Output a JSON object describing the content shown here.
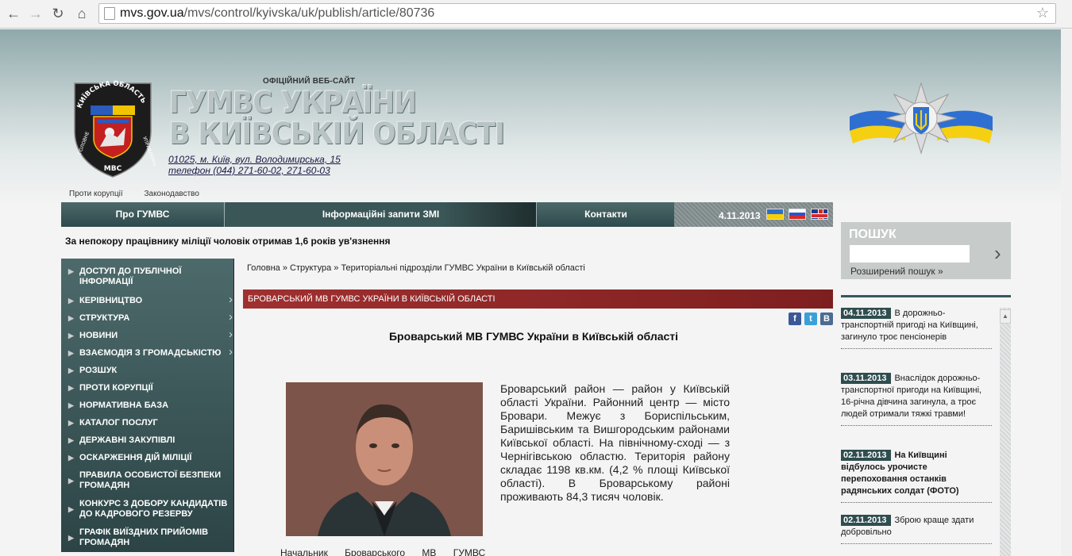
{
  "browser": {
    "url_host": "mvs.gov.ua",
    "url_path": "/mvs/control/kyivska/uk/publish/article/80736"
  },
  "header": {
    "official_label": "ОФІЦІЙНИЙ ВЕБ-САЙТ",
    "title_line1": "ГУМВС УКРАЇНИ",
    "title_line2": "В КИЇВСЬКІЙ ОБЛАСТІ",
    "address_line1": "01025, м. Київ, вул. Володимирська, 15",
    "address_line2": "телефон (044) 271-60-02, 271-60-03",
    "emblem_top": "КИЇВСЬКА ОБЛАСТЬ",
    "emblem_bottom": "ГОЛОВНЕ МВС УПРАВЛІННЯ"
  },
  "toplinks": [
    "Проти корупції",
    "Законодавство"
  ],
  "menu": {
    "items": [
      "Про ГУМВС",
      "Інформаційні запити ЗМІ",
      "Контакти"
    ],
    "date": "4.11.2013"
  },
  "ticker": "За непокору працівнику міліції чоловік отримав 1,6 років ув'язнення",
  "sidebar": {
    "items": [
      {
        "label": "ДОСТУП ДО ПУБЛІЧНОЇ ІНФОРМАЦІЇ",
        "arrow": ""
      },
      {
        "label": "КЕРІВНИЦТВО",
        "arrow": "›"
      },
      {
        "label": "СТРУКТУРА",
        "arrow": "›"
      },
      {
        "label": "НОВИНИ",
        "arrow": "›"
      },
      {
        "label": "ВЗАЄМОДІЯ З ГРОМАДСЬКІСТЮ",
        "arrow": "›"
      },
      {
        "label": "РОЗШУК",
        "arrow": ""
      },
      {
        "label": "ПРОТИ КОРУПЦІЇ",
        "arrow": ""
      },
      {
        "label": "НОРМАТИВНА БАЗА",
        "arrow": ""
      },
      {
        "label": "КАТАЛОГ ПОСЛУГ",
        "arrow": ""
      },
      {
        "label": "ДЕРЖАВНІ ЗАКУПІВЛІ",
        "arrow": ""
      },
      {
        "label": "ОСКАРЖЕННЯ ДІЙ МІЛІЦІЇ",
        "arrow": ""
      },
      {
        "label": "ПРАВИЛА ОСОБИСТОЇ БЕЗПЕКИ ГРОМАДЯН",
        "arrow": ""
      },
      {
        "label": "КОНКУРС З ДОБОРУ КАНДИДАТІВ ДО КАДРОВОГО РЕЗЕРВУ",
        "arrow": ""
      },
      {
        "label": "ГРАФІК ВИЇЗДНИХ ПРИЙОМІВ ГРОМАДЯН",
        "arrow": ""
      }
    ]
  },
  "search": {
    "label": "ПОШУК",
    "value": "",
    "advanced": "Розширений пошук »"
  },
  "news": [
    {
      "date": "04.11.2013",
      "text": "В дорожньо-транспортній пригоді на Київщині, загинуло троє пенсіонерів",
      "bold": false
    },
    {
      "date": "03.11.2013",
      "text": "Внаслідок дорожньо-транспортної пригоди на Київщині, 16-річна дівчина загинула, а троє людей отримали тяжкі травми!",
      "bold": false
    },
    {
      "date": "02.11.2013",
      "text": "На Київщині відбулось урочисте перепоховання останків радянських солдат (ФОТО)",
      "bold": true
    },
    {
      "date": "02.11.2013",
      "text": "Зброю краще здати добровільно",
      "bold": false
    }
  ],
  "main": {
    "breadcrumb": "Головна » Структура » Територіальні підрозділи ГУМВС України в Київській області",
    "section_bar": "БРОВАРСЬКИЙ МВ ГУМВС УКРАЇНИ В КИЇВСЬКІЙ ОБЛАСТІ",
    "share": {
      "fb": "f",
      "tw": "t",
      "vk": "B"
    },
    "title": "Броварський МВ ГУМВС України в Київській області",
    "paragraph1": "Броварський район — район у Київській області України. Районний центр — місто Бровари. Межує з Бориспільським, Баришівським та Вишгородським районами Київської області. На північному-сході — з Чернігівською областю. Територія району складає 1198 кв.км. (4,2 % площі Київської області). В Броварському районі проживають 84,3 тисяч чоловік.",
    "paragraph2_start": "Начальник Броварського МВ ГУМВС"
  }
}
